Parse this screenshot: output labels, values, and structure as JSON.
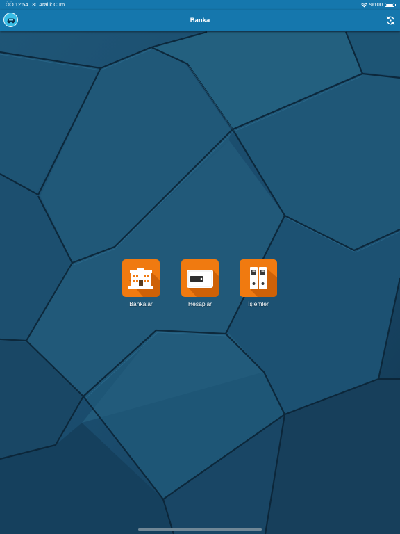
{
  "status_bar": {
    "time": "ÖÖ 12:54",
    "date": "30 Aralık Cum",
    "battery_percent": "%100",
    "battery_level": 1.0,
    "wifi_icon": "wifi-icon",
    "battery_icon": "battery-icon"
  },
  "nav_bar": {
    "title": "Banka",
    "logo_icon": "car-logo-icon",
    "refresh_icon": "refresh-icon"
  },
  "menu": {
    "items": [
      {
        "label": "Bankalar",
        "icon": "bank-building-icon"
      },
      {
        "label": "Hesaplar",
        "icon": "wallet-icon"
      },
      {
        "label": "İşlemler",
        "icon": "binders-icon"
      }
    ]
  },
  "colors": {
    "bar": "#1577ad",
    "tile": "#f07a10",
    "background": "#1b4a6b"
  }
}
